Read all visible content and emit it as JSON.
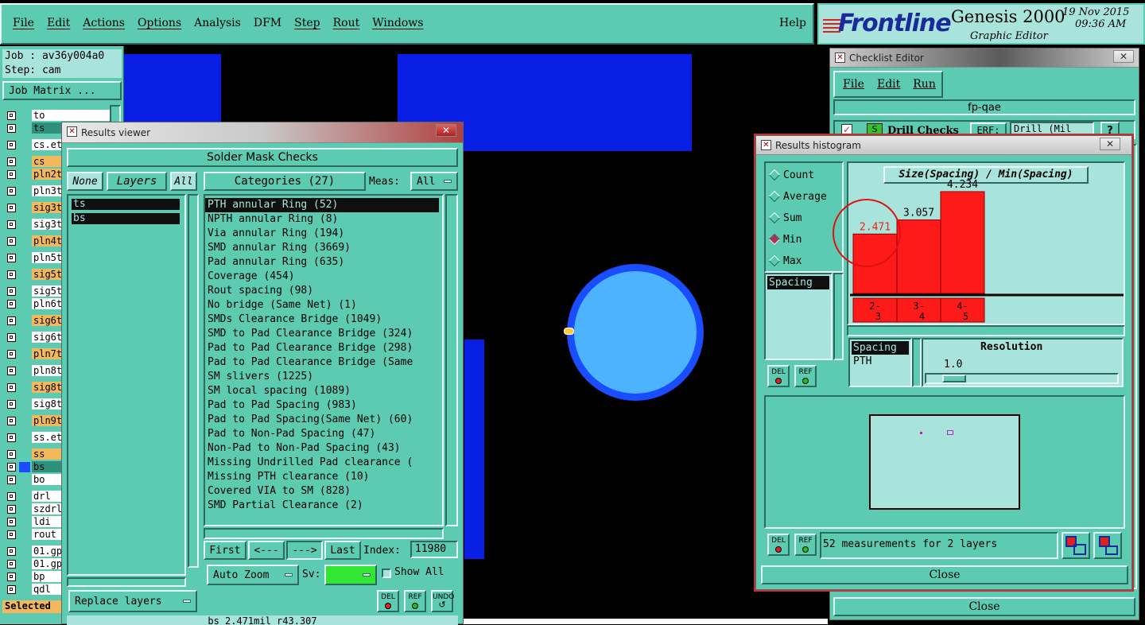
{
  "menubar": {
    "items": [
      "File",
      "Edit",
      "Actions",
      "Options",
      "Analysis",
      "DFM",
      "Step",
      "Rout",
      "Windows"
    ],
    "help": "Help"
  },
  "brand": {
    "logo": "Frontline",
    "product": "Genesis 2000",
    "date": "19 Nov 2015",
    "time": "09:36 AM",
    "subtitle": "Graphic Editor"
  },
  "job": {
    "job_label": "Job : av36y004a0",
    "step_label": "Step: cam",
    "matrix_button": "Job Matrix ..."
  },
  "layers": [
    {
      "name": "to",
      "color": "#ffffff"
    },
    {
      "name": "ts",
      "color": "#2e8f7a"
    },
    {
      "name": "cs.et",
      "color": "#ffffff"
    },
    {
      "name": "cs",
      "color": "#f2b85c"
    },
    {
      "name": "pln2t",
      "color": "#f2b85c"
    },
    {
      "name": "pln3t",
      "color": "#ffffff"
    },
    {
      "name": "sig3t",
      "color": "#f2b85c"
    },
    {
      "name": "sig3t",
      "color": "#ffffff"
    },
    {
      "name": "pln4t",
      "color": "#f2b85c"
    },
    {
      "name": "pln5t",
      "color": "#ffffff"
    },
    {
      "name": "sig5t",
      "color": "#f2b85c"
    },
    {
      "name": "sig5t",
      "color": "#ffffff"
    },
    {
      "name": "pln6t",
      "color": "#ffffff"
    },
    {
      "name": "sig6t",
      "color": "#f2b85c"
    },
    {
      "name": "sig6t",
      "color": "#ffffff"
    },
    {
      "name": "pln7t",
      "color": "#f2b85c"
    },
    {
      "name": "pln8t",
      "color": "#ffffff"
    },
    {
      "name": "sig8t",
      "color": "#f2b85c"
    },
    {
      "name": "sig8t",
      "color": "#ffffff"
    },
    {
      "name": "pln9t",
      "color": "#f2b85c"
    },
    {
      "name": "ss.et",
      "color": "#ffffff"
    },
    {
      "name": "ss",
      "color": "#f2b85c"
    },
    {
      "name": "bs",
      "color": "#2e8f7a"
    },
    {
      "name": "bo",
      "color": "#ffffff"
    },
    {
      "name": "drl",
      "color": "#ffffff"
    },
    {
      "name": "szdrl",
      "color": "#ffffff"
    },
    {
      "name": "ldi",
      "color": "#ffffff"
    },
    {
      "name": "rout",
      "color": "#ffffff"
    },
    {
      "name": "01.gp",
      "color": "#ffffff"
    },
    {
      "name": "01.gp",
      "color": "#ffffff"
    },
    {
      "name": "bp",
      "color": "#ffffff"
    },
    {
      "name": "qdl",
      "color": "#ffffff"
    }
  ],
  "selected_label": "Selected",
  "results_viewer": {
    "title": "Results viewer",
    "header": "Solder Mask Checks",
    "none_button": "None",
    "layers_button": "Layers",
    "all_button": "All",
    "categories_button": "Categories (27)",
    "meas_label": "Meas:",
    "meas_value": "All",
    "layer_list": [
      "ts",
      "bs"
    ],
    "categories": [
      "PTH annular Ring (52)",
      "NPTH annular Ring (8)",
      "Via annular Ring (194)",
      "SMD annular Ring (3669)",
      "Pad annular Ring (635)",
      "Coverage (454)",
      "Rout spacing (98)",
      "No bridge (Same Net) (1)",
      "SMDs Clearance Bridge (1049)",
      "SMD to Pad Clearance Bridge (324)",
      "Pad to Pad Clearance Bridge (298)",
      "Pad to Pad Clearance Bridge (Same",
      "SM slivers (1225)",
      "SM local spacing (1089)",
      "Pad to Pad Spacing (983)",
      "Pad to Pad Spacing(Same Net) (60)",
      "Pad to Non-Pad Spacing (47)",
      "Non-Pad to Non-Pad Spacing (43)",
      "Missing Undrilled Pad clearance (",
      "Missing PTH clearance (10)",
      "Covered VIA to SM (828)",
      "SMD Partial Clearance (2)"
    ],
    "nav": {
      "first": "First",
      "prev": "<---",
      "next": "--->",
      "last": "Last"
    },
    "index_label": "Index:",
    "index_value": "11980",
    "auto_zoom": "Auto Zoom",
    "sv_label": "Sv:",
    "show_all": "Show All",
    "replace_layers": "Replace layers",
    "del": "DEL",
    "ref": "REF",
    "undo": "UNDO",
    "status": "bs 2.471mil  r43.307"
  },
  "checklist_editor": {
    "title": "Checklist Editor",
    "menu": [
      "File",
      "Edit",
      "Run"
    ],
    "name": "fp-qae",
    "row_label": "Drill Checks",
    "erf_label": "ERF:",
    "drill_value": "Drill (Mil",
    "help": "?",
    "close": "Close"
  },
  "histogram": {
    "title": "Results histogram",
    "modes": [
      "Count",
      "Average",
      "Sum",
      "Min",
      "Max"
    ],
    "selected_mode": "Min",
    "chart_title": "Size(Spacing) / Min(Spacing)",
    "bars": [
      {
        "label": "2.471",
        "bin": "2-\n3",
        "value": 2.471,
        "highlight": true
      },
      {
        "label": "3.057",
        "bin": "3-\n4",
        "value": 3.057,
        "highlight": false
      },
      {
        "label": "4.234",
        "bin": "4-\n5",
        "value": 4.234,
        "highlight": false
      }
    ],
    "measure_list": [
      "Spacing"
    ],
    "lower_list": [
      "Spacing",
      "PTH"
    ],
    "resolution_label": "Resolution",
    "resolution_value": "1.0",
    "status": "52 measurements for 2 layers",
    "del": "DEL",
    "ref": "REF",
    "close": "Close"
  },
  "colors": {
    "panel": "#5ccbb2",
    "panel_light": "#a9e4dc",
    "bar": "#ff1a1a",
    "pad_outer": "#1a4dff",
    "pad_inner": "#4db3ff",
    "mask_blue": "#0a1fe6",
    "highlight_circle": "#e01010"
  }
}
